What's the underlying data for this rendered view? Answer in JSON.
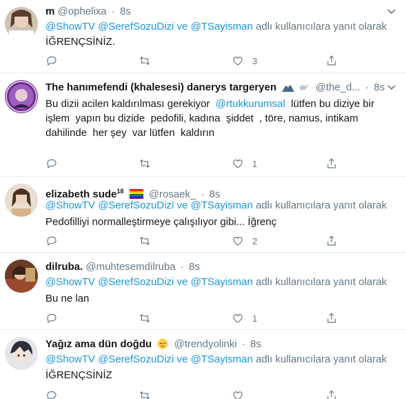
{
  "reply_prefix": "adlı kullanıcılara yanıt olarak",
  "tweets": [
    {
      "name": "m",
      "handle": "@ophelixa",
      "dot": "·",
      "time": "8s",
      "mentions": [
        "@ShowTV",
        "@SerefSozuDizi",
        "ve",
        "@TSayisman"
      ],
      "body": "İĞRENÇSİNİZ.",
      "like_count": "3",
      "avatar": "woman-photo-avatar"
    },
    {
      "name": "The hanımefendi (khalesesi) danerys targeryen",
      "handle": "@the_d...",
      "dot": "·",
      "time": "8s",
      "mentions": [],
      "body_pre": "Bu dizii acilen kaldırılması gerekiyor  ",
      "body_mention": "@rtukkurumsal",
      "body_post": "  lütfen bu diziye bir\nişlem  yapın bu dizide  pedofili, kadına  şiddet  , töre, namus, intikam\ndahilinde  her şey  var lütfen  kaldırın",
      "like_count": "1",
      "avatar": "purple-circle-avatar"
    },
    {
      "name": "elizabeth sude",
      "name_sup": "18",
      "handle": "@rosaek_",
      "dot": "·",
      "time": "8s",
      "mentions": [
        "@ShowTV",
        "@SerefSozuDizi",
        "ve",
        "@TSayisman"
      ],
      "body": "Pedofilliyi normalleştirmeye çalışılıyor gibi... İğrenç",
      "like_count": "2",
      "avatar": "woman-photo-avatar"
    },
    {
      "name": "dilruba.",
      "handle": "@muhtesemdilruba",
      "dot": "·",
      "time": "8s",
      "mentions": [
        "@ShowTV",
        "@SerefSozuDizi",
        "ve",
        "@TSayisman"
      ],
      "body": "Bu ne lan",
      "like_count": "1",
      "avatar": "painting-avatar"
    },
    {
      "name": "Yağız ama dün doğdu",
      "handle": "@trendyolinki",
      "dot": "·",
      "time": "8s",
      "mentions": [
        "@ShowTV",
        "@SerefSozuDizi",
        "ve",
        "@TSayisman"
      ],
      "body": "İĞRENÇSİNİZ",
      "like_count": "",
      "avatar": "anime-avatar"
    }
  ],
  "colors": {
    "link": "#1b95e0",
    "muted": "#657786",
    "text": "#14171a",
    "divider": "#e6ecf0"
  }
}
